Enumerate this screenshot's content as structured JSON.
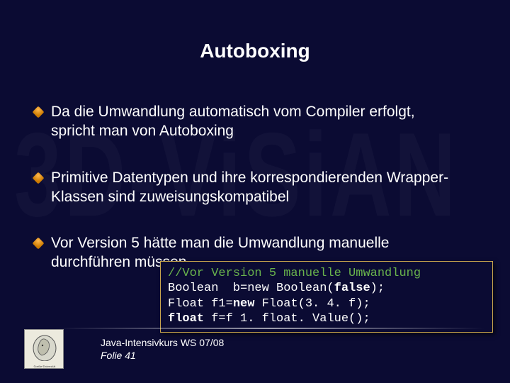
{
  "watermark": "3D-ViSiAN",
  "title": "Autoboxing",
  "bullets": [
    "Da die Umwandlung automatisch vom Compiler erfolgt, spricht man von Autoboxing",
    "Primitive Datentypen und ihre korrespondierenden Wrapper-Klassen sind zuweisungskompatibel",
    "Vor Version 5 hätte man die Umwandlung manuelle durchführen müssen"
  ],
  "code": {
    "l1_comment": "//Vor Version 5 manuelle Umwandlung",
    "l2_a": "Boolean  b=new Boolean(",
    "l2_kw": "false",
    "l2_b": ");",
    "l3_a": "Float f1=",
    "l3_kw": "new",
    "l3_b": " Float(3. 4. f);",
    "l4_kw": "float",
    "l4_a": " f=f 1. float. Value();"
  },
  "footer": {
    "course": "Java-Intensivkurs WS 07/08",
    "folie": "Folie 41"
  }
}
